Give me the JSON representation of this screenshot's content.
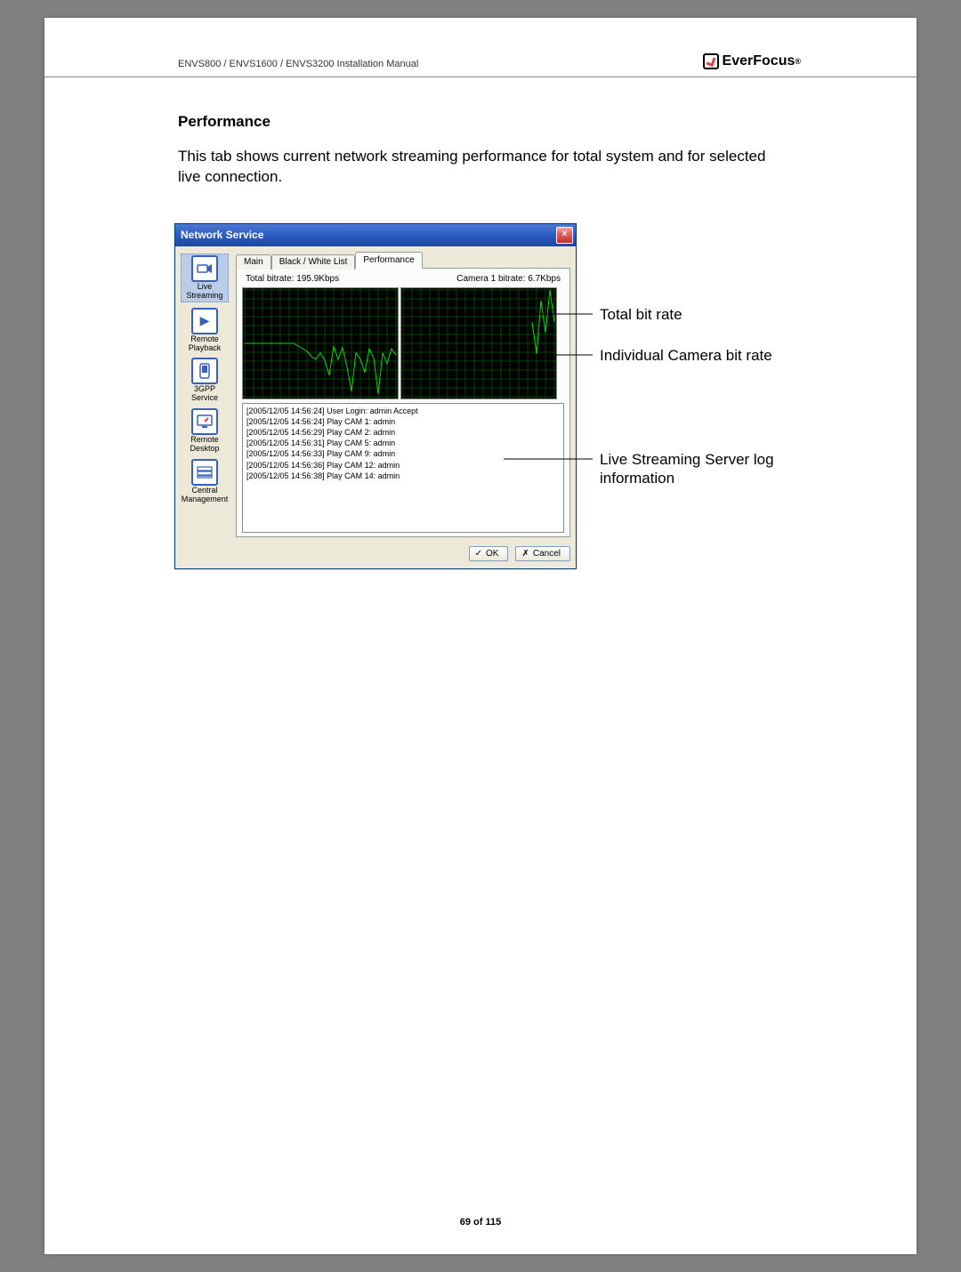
{
  "header": {
    "doc_title": "ENVS800 / ENVS1600 / ENVS3200 Installation Manual",
    "brand": "EverFocus"
  },
  "section": {
    "title": "Performance",
    "body": "This tab shows current network streaming performance for total system and for selected live connection."
  },
  "dialog": {
    "title": "Network Service",
    "sidebar": [
      {
        "label": "Live Streaming"
      },
      {
        "label": "Remote Playback"
      },
      {
        "label": "3GPP Service"
      },
      {
        "label": "Remote Desktop"
      },
      {
        "label": "Central Management"
      }
    ],
    "tabs": [
      {
        "label": "Main"
      },
      {
        "label": "Black / White List"
      },
      {
        "label": "Performance"
      }
    ],
    "total_bitrate_label": "Total bitrate: 195.9Kbps",
    "camera_bitrate_label": "Camera 1 bitrate: 6.7Kbps",
    "log": [
      "[2005/12/05 14:56:24]  User Login: admin Accept",
      "[2005/12/05 14:56:24]  Play CAM 1: admin",
      "[2005/12/05 14:56:29]  Play CAM 2: admin",
      "[2005/12/05 14:56:31]  Play CAM 5: admin",
      "[2005/12/05 14:56:33]  Play CAM 9: admin",
      "[2005/12/05 14:56:36]  Play CAM 12: admin",
      "[2005/12/05 14:56:38]  Play CAM 14: admin"
    ],
    "ok_label": "OK",
    "cancel_label": "Cancel"
  },
  "callouts": {
    "c1": "Total bit rate",
    "c2": "Individual Camera bit rate",
    "c3": "Live Streaming Server log information"
  },
  "footer": {
    "page": "69 of 115"
  },
  "chart_data": [
    {
      "type": "line",
      "title": "Total bitrate",
      "ylabel": "Kbps",
      "x": [
        0,
        5,
        10,
        15,
        20,
        25,
        30,
        35,
        40,
        45,
        50,
        55,
        60,
        65,
        70,
        75,
        80,
        85,
        90,
        95,
        100,
        105,
        110,
        115,
        120,
        125,
        130,
        135,
        140,
        145,
        150,
        155,
        160,
        165,
        170
      ],
      "values": [
        100,
        100,
        100,
        100,
        100,
        100,
        100,
        100,
        100,
        100,
        100,
        100,
        95,
        90,
        85,
        75,
        70,
        82,
        68,
        40,
        95,
        70,
        92,
        55,
        10,
        82,
        70,
        45,
        90,
        72,
        5,
        82,
        62,
        90,
        78
      ],
      "ylim": [
        0,
        200
      ]
    },
    {
      "type": "line",
      "title": "Camera 1 bitrate",
      "ylabel": "Kbps",
      "x": [
        0,
        5,
        10,
        15,
        20,
        25,
        30,
        35,
        40,
        45,
        50,
        55,
        60,
        65,
        70,
        75,
        80,
        85,
        90,
        95,
        100,
        105,
        110,
        115,
        120,
        125,
        130,
        135,
        140,
        145,
        150,
        155,
        160,
        165,
        170
      ],
      "values": [
        null,
        null,
        null,
        null,
        null,
        null,
        null,
        null,
        null,
        null,
        null,
        null,
        null,
        null,
        null,
        null,
        null,
        null,
        null,
        null,
        null,
        null,
        null,
        null,
        null,
        null,
        null,
        null,
        null,
        7,
        4,
        9,
        6,
        10,
        7
      ],
      "ylim": [
        0,
        10
      ]
    }
  ]
}
